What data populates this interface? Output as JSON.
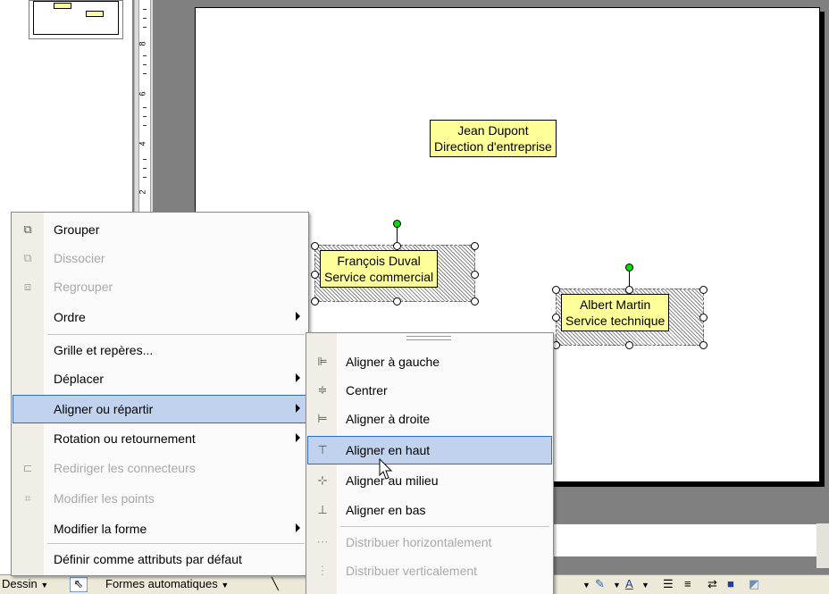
{
  "ruler": {
    "labels": [
      "8",
      "6",
      "4",
      "2"
    ]
  },
  "slide": {
    "boxes": [
      {
        "line1": "Jean Dupont",
        "line2": "Direction d'entreprise"
      },
      {
        "line1": "François Duval",
        "line2": "Service commercial"
      },
      {
        "line1": "Albert Martin",
        "line2": "Service technique"
      }
    ]
  },
  "context_menu": {
    "items": [
      {
        "label": "Grouper",
        "icon": "group-icon",
        "enabled": true
      },
      {
        "label": "Dissocier",
        "icon": "ungroup-icon",
        "enabled": false
      },
      {
        "label": "Regrouper",
        "icon": "regroup-icon",
        "enabled": false
      },
      {
        "label": "Ordre",
        "submenu": true,
        "enabled": true
      },
      {
        "label": "Grille et repères...",
        "enabled": true
      },
      {
        "label": "Déplacer",
        "submenu": true,
        "enabled": true
      },
      {
        "label": "Aligner ou répartir",
        "submenu": true,
        "enabled": true,
        "highlighted": true
      },
      {
        "label": "Rotation ou retournement",
        "submenu": true,
        "enabled": true
      },
      {
        "label": "Rediriger les connecteurs",
        "icon": "connector-icon",
        "enabled": false
      },
      {
        "label": "Modifier les points",
        "icon": "edit-points-icon",
        "enabled": false
      },
      {
        "label": "Modifier la forme",
        "submenu": true,
        "enabled": true
      },
      {
        "label": "Définir comme attributs par défaut",
        "enabled": true
      }
    ]
  },
  "align_submenu": {
    "items": [
      {
        "label": "Aligner à gauche",
        "icon": "align-left-icon",
        "enabled": true
      },
      {
        "label": "Centrer",
        "icon": "align-center-icon",
        "enabled": true
      },
      {
        "label": "Aligner à droite",
        "icon": "align-right-icon",
        "enabled": true
      },
      {
        "label": "Aligner en haut",
        "icon": "align-top-icon",
        "enabled": true,
        "highlighted": true
      },
      {
        "label": "Aligner au milieu",
        "icon": "align-middle-icon",
        "enabled": true
      },
      {
        "label": "Aligner en bas",
        "icon": "align-bottom-icon",
        "enabled": true
      },
      {
        "label": "Distribuer horizontalement",
        "icon": "distribute-horizontal-icon",
        "enabled": false
      },
      {
        "label": "Distribuer verticalement",
        "icon": "distribute-vertical-icon",
        "enabled": false
      }
    ]
  },
  "toolbar": {
    "draw_label": "Dessin",
    "autoshapes_label": "Formes automatiques"
  },
  "colors": {
    "highlight": "#c1d2ee",
    "highlight_border": "#316ac5",
    "shape_fill": "#ffff99",
    "rotate_handle": "#00dd00"
  }
}
